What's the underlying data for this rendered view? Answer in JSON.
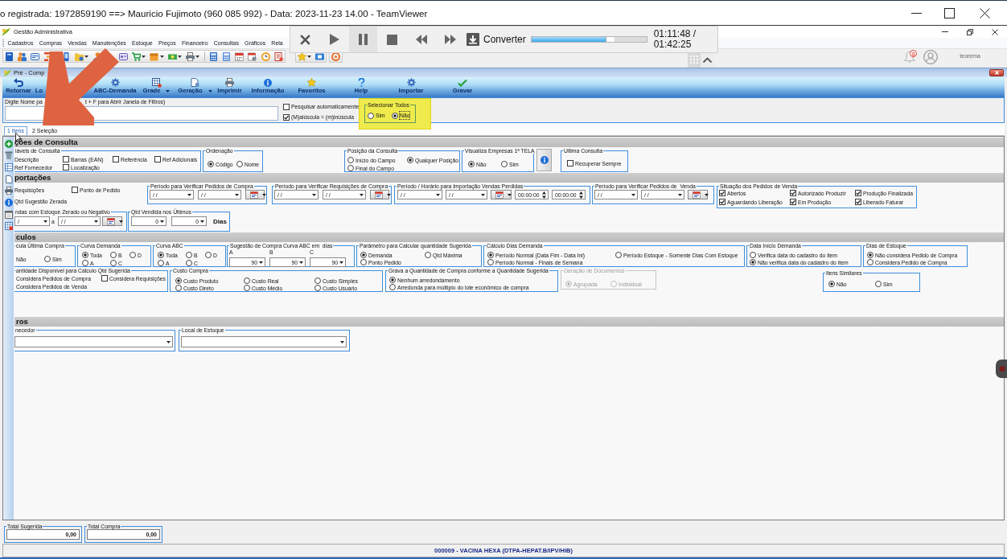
{
  "remote_window": {
    "title": "o registrada: 1972859190 ==> Mauricio Fujimoto (960 085 992) - Data: 2023-11-23 14.00 - TeamViewer"
  },
  "app": {
    "title": "Gestão Administrativa",
    "menu": [
      "Cadastros",
      "Compras",
      "Vendas",
      "Manutenções",
      "Estoque",
      "Preços",
      "Financeiro",
      "Consultas",
      "Gráficos",
      "Rela"
    ],
    "notification_count": "0",
    "user": "teorema"
  },
  "media_bar": {
    "action": "Converter",
    "level": 0.72,
    "time": "01:11:48 / 01:42:25"
  },
  "child_window": {
    "title": "Pré - Comp",
    "toolbar": [
      {
        "label": "Retornar",
        "dropdown": false
      },
      {
        "label": "Lo",
        "dropdown": false
      },
      {
        "label": "ABC-Demanda",
        "dropdown": false
      },
      {
        "label": "Grade",
        "dropdown": true
      },
      {
        "label": "Geração",
        "dropdown": true
      },
      {
        "label": "Imprimir",
        "dropdown": false
      },
      {
        "label": "Informação",
        "dropdown": false
      },
      {
        "label": "Favoritos",
        "dropdown": false
      },
      {
        "label": "Help",
        "dropdown": false
      },
      {
        "label": "Importar",
        "dropdown": false
      },
      {
        "label": "Gravar",
        "dropdown": false
      }
    ],
    "search": {
      "label_start": "Digite Nome pa",
      "label_end": "t + F para Abrir Janela de Filtros)",
      "options": [
        {
          "label": "Pesquisar automaticamente",
          "checked": false
        },
        {
          "label": "(M)aiúscula = (m)inúscula",
          "checked": true
        }
      ]
    },
    "select_all": {
      "title": "Selecionar Todos",
      "highlighted": true,
      "options": [
        {
          "label": "Sim",
          "selected": false
        },
        {
          "label": "Não",
          "selected": true
        }
      ]
    },
    "tabs": [
      {
        "label": "1 Itens",
        "selected": true
      },
      {
        "label": "2 Seleção",
        "selected": false
      }
    ],
    "sections": [
      {
        "title": "ções de Consulta",
        "panels": [
          {
            "kind": "group",
            "title": "iáveis de Consulta",
            "disabled": false,
            "items": [
              {
                "kind": "label",
                "text": "Descrição"
              },
              {
                "kind": "checkbox",
                "label": "Barras (EAN)",
                "checked": false
              },
              {
                "kind": "checkbox",
                "label": "Referência",
                "checked": false
              },
              {
                "kind": "checkbox",
                "label": "Ref Adicionais",
                "checked": false
              },
              {
                "kind": "label",
                "text": "Ref Fornecedor"
              },
              {
                "kind": "checkbox",
                "label": "Localização",
                "checked": false
              }
            ]
          },
          {
            "kind": "group",
            "title": "Ordenação",
            "disabled": false,
            "items": [
              {
                "kind": "radio",
                "label": "Código",
                "selected": true
              },
              {
                "kind": "radio",
                "label": "Nome",
                "selected": false
              }
            ]
          },
          {
            "kind": "group",
            "title": "Posição da Consulta",
            "disabled": false,
            "items": [
              {
                "kind": "radio",
                "label": "Início do Campo",
                "selected": false
              },
              {
                "kind": "radio",
                "label": "Qualquer Posição",
                "selected": true
              },
              {
                "kind": "radio",
                "label": "Final do Campo",
                "selected": false
              }
            ]
          },
          {
            "kind": "group",
            "title": "Visualiza Empresas 1ª TELA",
            "disabled": false,
            "items": [
              {
                "kind": "radio",
                "label": "Não",
                "selected": true
              },
              {
                "kind": "radio",
                "label": "Sim",
                "selected": false
              }
            ]
          },
          {
            "kind": "info_button"
          },
          {
            "kind": "group",
            "title": "Ultima Consulta",
            "disabled": false,
            "items": [
              {
                "kind": "checkbox",
                "label": "Recuperar Sempre",
                "checked": false
              }
            ]
          }
        ]
      },
      {
        "title": "portações",
        "panels": [
          {
            "kind": "plain",
            "items": [
              {
                "kind": "label",
                "text": "Requisições"
              },
              {
                "kind": "checkbox",
                "label": "Ponto de Pedido",
                "checked": false
              },
              {
                "kind": "label",
                "text": "Qtd Sugestão Zerada"
              }
            ]
          },
          {
            "kind": "group",
            "title": "Período para Verificar Pedidos de Compra",
            "disabled": false,
            "items": [
              {
                "kind": "date",
                "value": "/ /"
              },
              {
                "kind": "date",
                "value": "/ /"
              },
              {
                "kind": "calendar"
              }
            ]
          },
          {
            "kind": "group",
            "title": "Período para Verificar Requisições de Compra",
            "disabled": false,
            "items": [
              {
                "kind": "date",
                "value": "/ /"
              },
              {
                "kind": "date",
                "value": "/ /"
              },
              {
                "kind": "calendar"
              }
            ]
          },
          {
            "kind": "group",
            "title": "Período / Horário para Importação Vendas Perdidas",
            "disabled": false,
            "items": [
              {
                "kind": "date",
                "value": "/ /"
              },
              {
                "kind": "date",
                "value": "/ /"
              },
              {
                "kind": "calendar"
              },
              {
                "kind": "time",
                "value": "00:00:00"
              },
              {
                "kind": "time",
                "value": "00:00:00"
              }
            ]
          },
          {
            "kind": "group",
            "title": "Período para Verificar Pedidos de  Venda",
            "disabled": false,
            "items": [
              {
                "kind": "date",
                "value": "/ /"
              },
              {
                "kind": "date",
                "value": "/ /"
              },
              {
                "kind": "calendar"
              }
            ]
          },
          {
            "kind": "group",
            "title": "Situação dos Pedidos de Venda",
            "disabled": false,
            "items": [
              {
                "kind": "checkbox",
                "label": "Abertos",
                "checked": true
              },
              {
                "kind": "checkbox",
                "label": "Autorizado Produzir",
                "checked": true
              },
              {
                "kind": "checkbox",
                "label": "Produção Finalizada",
                "checked": true
              },
              {
                "kind": "checkbox",
                "label": "Aguardando Liberação",
                "checked": true
              },
              {
                "kind": "checkbox",
                "label": "Em Produção",
                "checked": true
              },
              {
                "kind": "checkbox",
                "label": "Liberado Faturar",
                "checked": true
              }
            ]
          },
          {
            "kind": "group",
            "title": "ndas com Estoque Zerado ou Negativo",
            "disabled": false,
            "items": [
              {
                "kind": "date",
                "value": "/"
              },
              {
                "kind": "label",
                "text": "a"
              },
              {
                "kind": "date",
                "value": "/ /"
              },
              {
                "kind": "calendar"
              }
            ]
          },
          {
            "kind": "group",
            "title": "Qtd Vendida nos Últimos",
            "disabled": false,
            "items": [
              {
                "kind": "number",
                "value": "0"
              },
              {
                "kind": "number",
                "value": "0"
              },
              {
                "kind": "unit",
                "text": "Dias"
              }
            ]
          }
        ]
      },
      {
        "title": "culos",
        "panels": [
          {
            "kind": "group",
            "title": "cula Última Compra",
            "disabled": false,
            "items": [
              {
                "kind": "label",
                "text": "Não"
              },
              {
                "kind": "radio",
                "label": "Sim",
                "selected": false
              }
            ]
          },
          {
            "kind": "group",
            "title": "Curva Demanda",
            "disabled": false,
            "items": [
              {
                "kind": "radio",
                "label": "Toda",
                "selected": true
              },
              {
                "kind": "radio",
                "label": "B",
                "selected": false
              },
              {
                "kind": "radio",
                "label": "D",
                "selected": false
              },
              {
                "kind": "radio",
                "label": "A",
                "selected": false
              },
              {
                "kind": "radio",
                "label": "C",
                "selected": false
              }
            ]
          },
          {
            "kind": "group",
            "title": "Curva ABC",
            "disabled": false,
            "items": [
              {
                "kind": "radio",
                "label": "Toda",
                "selected": true
              },
              {
                "kind": "radio",
                "label": "B",
                "selected": false
              },
              {
                "kind": "radio",
                "label": "D",
                "selected": false
              },
              {
                "kind": "radio",
                "label": "A",
                "selected": false
              },
              {
                "kind": "radio",
                "label": "C",
                "selected": false
              }
            ]
          },
          {
            "kind": "group",
            "title": "Sugestão de Compra Curva ABC em  dias",
            "disabled": false,
            "items": [
              {
                "kind": "label",
                "text": "A"
              },
              {
                "kind": "label",
                "text": "B"
              },
              {
                "kind": "label",
                "text": "C"
              },
              {
                "kind": "number",
                "value": "90"
              },
              {
                "kind": "number",
                "value": "90"
              },
              {
                "kind": "number",
                "value": "90"
              }
            ]
          },
          {
            "kind": "group",
            "title": "Parâmetro para Calcular quantidade Sugerida",
            "disabled": false,
            "items": [
              {
                "kind": "radio",
                "label": "Demanda",
                "selected": true
              },
              {
                "kind": "radio",
                "label": "Qtd Máxima",
                "selected": false
              },
              {
                "kind": "radio",
                "label": "Ponto Pedido",
                "selected": false
              }
            ]
          },
          {
            "kind": "group",
            "title": "Cálculo Dias Demanda",
            "disabled": false,
            "items": [
              {
                "kind": "radio",
                "label": "Período Normal (Data Fim - Data Ini)",
                "selected": true
              },
              {
                "kind": "radio",
                "label": "Período Estoque - Somente Dias Com Estoque",
                "selected": false
              },
              {
                "kind": "radio",
                "label": "Período Normal - Finais de Semana",
                "selected": false
              }
            ]
          },
          {
            "kind": "group",
            "title": "Data Início Demanda",
            "disabled": false,
            "items": [
              {
                "kind": "radio",
                "label": "Verifica data do cadastro do item",
                "selected": false
              },
              {
                "kind": "radio",
                "label": "Não verifica data do cadastro do item",
                "selected": true
              }
            ]
          },
          {
            "kind": "group",
            "title": "Dias de Estoque",
            "disabled": false,
            "items": [
              {
                "kind": "radio",
                "label": "Não considera Pedido de Compra",
                "selected": true
              },
              {
                "kind": "radio",
                "label": "Considera Pedido de Compra",
                "selected": false
              }
            ]
          },
          {
            "kind": "group",
            "title": "antidade Disponível para Cálculo Qtd Sugerida",
            "disabled": false,
            "items": [
              {
                "kind": "label",
                "text": "Considera Pedidos de Compra"
              },
              {
                "kind": "checkbox",
                "label": "Considera Requisições",
                "checked": false
              },
              {
                "kind": "label",
                "text": "Considera Pedidos de Venda"
              }
            ]
          },
          {
            "kind": "group",
            "title": "Custo Compra",
            "disabled": false,
            "items": [
              {
                "kind": "radio",
                "label": "Custo Produto",
                "selected": true
              },
              {
                "kind": "radio",
                "label": "Custo Real",
                "selected": false
              },
              {
                "kind": "radio",
                "label": "Custo Simples",
                "selected": false
              },
              {
                "kind": "radio",
                "label": "Custo Direto",
                "selected": false
              },
              {
                "kind": "radio",
                "label": "Custo Médio",
                "selected": false
              },
              {
                "kind": "radio",
                "label": "Custo Usuário",
                "selected": false
              }
            ]
          },
          {
            "kind": "group",
            "title": "Grava a Quantidade de Compra conforme a Quantidade Sugerida",
            "disabled": false,
            "items": [
              {
                "kind": "radio",
                "label": "Nenhum arredondamento",
                "selected": true
              },
              {
                "kind": "radio",
                "label": "Arredonda para múltiplo do lote econômico de compra",
                "selected": false
              }
            ]
          },
          {
            "kind": "group",
            "title": "Geração de Documentos",
            "disabled": true,
            "items": [
              {
                "kind": "radio",
                "label": "Agrupada",
                "selected": true
              },
              {
                "kind": "radio",
                "label": "Individual",
                "selected": false
              }
            ]
          },
          {
            "kind": "group",
            "title": "Itens Similares",
            "disabled": false,
            "items": [
              {
                "kind": "radio",
                "label": "Não",
                "selected": true
              },
              {
                "kind": "radio",
                "label": "Sim",
                "selected": false
              }
            ]
          }
        ]
      },
      {
        "title": "ros",
        "panels": [
          {
            "kind": "group",
            "title": "necedor",
            "disabled": false,
            "items": [
              {
                "kind": "combo"
              }
            ]
          },
          {
            "kind": "group",
            "title": "Local de Estoque",
            "disabled": false,
            "items": [
              {
                "kind": "combo"
              }
            ]
          }
        ]
      }
    ],
    "totals": [
      {
        "label": "Total Sugerida",
        "value": "0,00"
      },
      {
        "label": "Total Compra",
        "value": "0,00"
      }
    ],
    "status_bar": "000009 - VACINA HEXA (DTPA-HEPAT.B/IPV/HIB)"
  }
}
